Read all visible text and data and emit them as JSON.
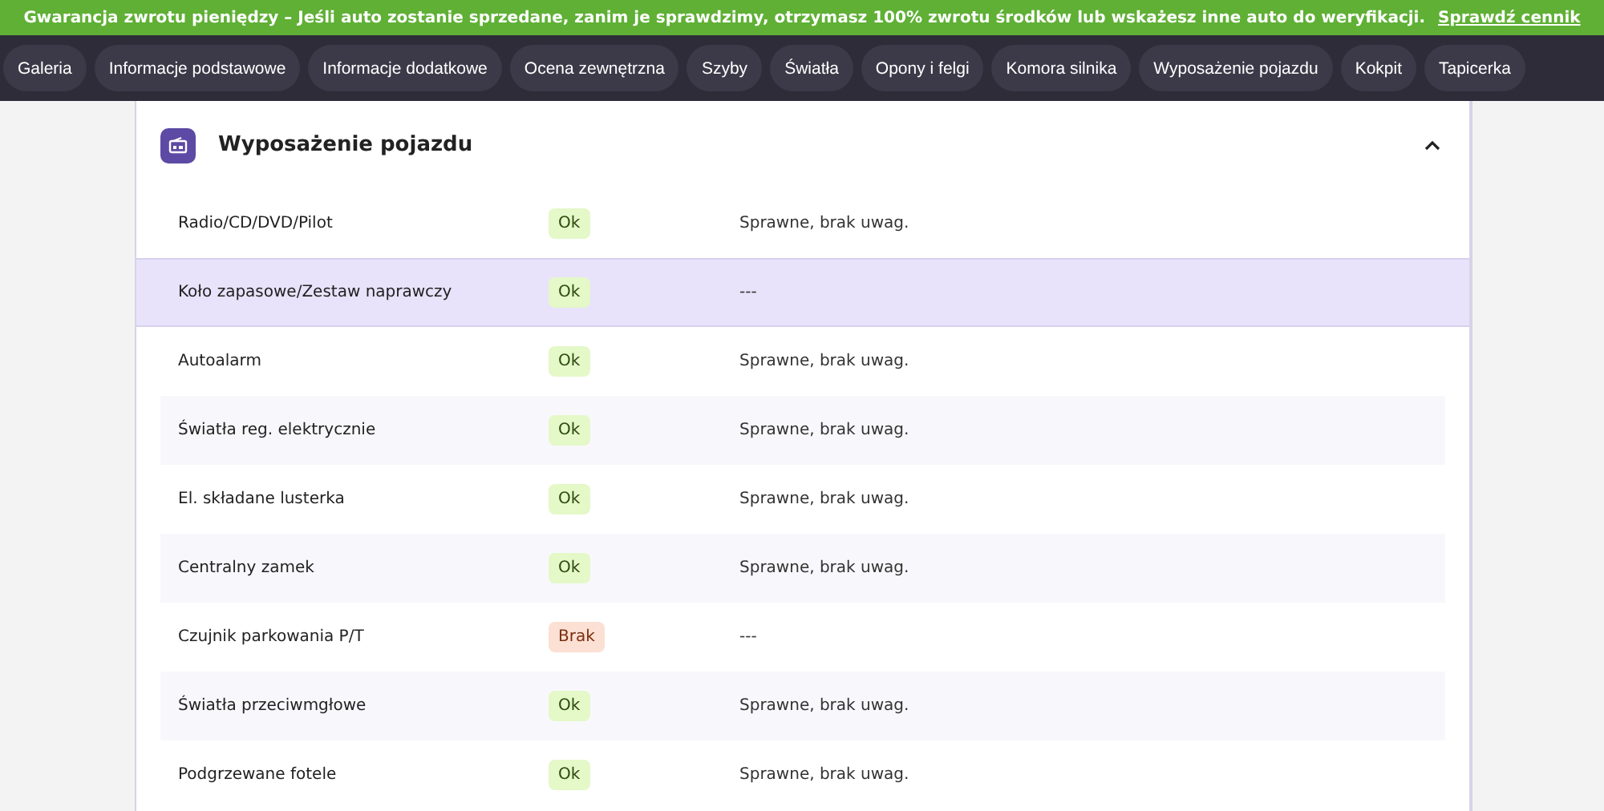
{
  "banner": {
    "text": "Gwarancja zwrotu pieniędzy – Jeśli auto zostanie sprzedane, zanim je sprawdzimy, otrzymasz 100% zwrotu środków lub wskażesz inne auto do weryfikacji.",
    "link": "Sprawdź cennik"
  },
  "nav": [
    {
      "label": "Galeria"
    },
    {
      "label": "Informacje podstawowe"
    },
    {
      "label": "Informacje dodatkowe"
    },
    {
      "label": "Ocena zewnętrzna"
    },
    {
      "label": "Szyby"
    },
    {
      "label": "Światła"
    },
    {
      "label": "Opony i felgi"
    },
    {
      "label": "Komora silnika"
    },
    {
      "label": "Wyposażenie pojazdu"
    },
    {
      "label": "Kokpit"
    },
    {
      "label": "Tapicerka"
    }
  ],
  "section": {
    "title": "Wyposażenie pojazdu",
    "expanded": true,
    "rows": [
      {
        "name": "Radio/CD/DVD/Pilot",
        "status": "Ok",
        "kind": "ok",
        "note": "Sprawne, brak uwag.",
        "selected": false
      },
      {
        "name": "Koło zapasowe/Zestaw naprawczy",
        "status": "Ok",
        "kind": "ok",
        "note": "---",
        "selected": true
      },
      {
        "name": "Autoalarm",
        "status": "Ok",
        "kind": "ok",
        "note": "Sprawne, brak uwag.",
        "selected": false
      },
      {
        "name": "Światła reg. elektrycznie",
        "status": "Ok",
        "kind": "ok",
        "note": "Sprawne, brak uwag.",
        "selected": false
      },
      {
        "name": "El. składane lusterka",
        "status": "Ok",
        "kind": "ok",
        "note": "Sprawne, brak uwag.",
        "selected": false
      },
      {
        "name": "Centralny zamek",
        "status": "Ok",
        "kind": "ok",
        "note": "Sprawne, brak uwag.",
        "selected": false
      },
      {
        "name": "Czujnik parkowania P/T",
        "status": "Brak",
        "kind": "missing",
        "note": "---",
        "selected": false
      },
      {
        "name": "Światła przeciwmgłowe",
        "status": "Ok",
        "kind": "ok",
        "note": "Sprawne, brak uwag.",
        "selected": false
      },
      {
        "name": "Podgrzewane fotele",
        "status": "Ok",
        "kind": "ok",
        "note": "Sprawne, brak uwag.",
        "selected": false
      }
    ]
  }
}
